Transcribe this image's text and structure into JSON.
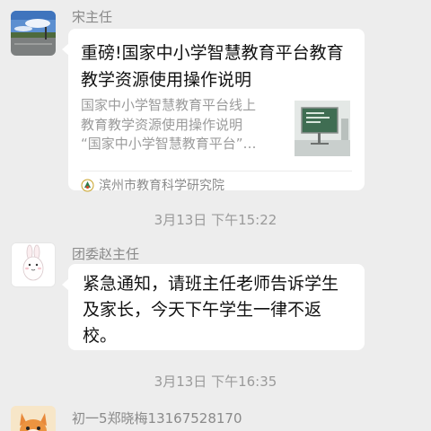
{
  "messages": [
    {
      "sender": "宋主任",
      "avatar": "landscape-photo-avatar",
      "card": {
        "title": "重磅!国家中小学智慧教育平台教育教学资源使用操作说明",
        "desc_lines": [
          "国家中小学智慧教育平台线上",
          "教育教学资源使用操作说明",
          "“国家中小学智慧教育平台”…"
        ],
        "thumbnail": "classroom-blackboard-thumbnail",
        "source": "滨州市教育科学研究院",
        "source_icon": "official-account-icon"
      }
    },
    {
      "sender": "团委赵主任",
      "avatar": "bunny-cartoon-avatar",
      "text": "紧急通知，请班主任老师告诉学生及家长，今天下午学生一律不返校。"
    },
    {
      "sender": "初一5郑晓梅13167528170",
      "avatar": "fox-cartoon-avatar"
    }
  ],
  "timestamps": [
    "3月13日 下午15:22",
    "3月13日 下午16:35"
  ],
  "colors": {
    "background": "#ededed",
    "bubble": "#ffffff",
    "meta_text": "#9a9a9a"
  }
}
